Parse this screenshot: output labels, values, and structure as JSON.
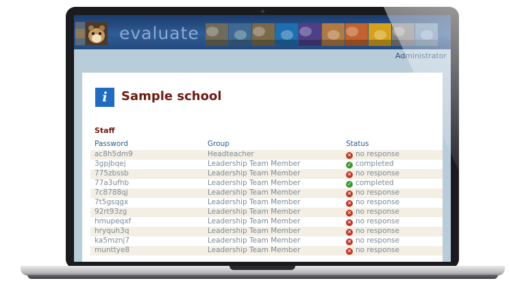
{
  "app": {
    "title": "evaluate"
  },
  "header": {
    "logo_thumb_icon": "hamster-photo-icon",
    "thumbnails": [
      {
        "name": "zebra-photo-icon",
        "color": "#6f6a5a"
      },
      {
        "name": "seascape-photo-icon",
        "color": "#3f6a8f"
      },
      {
        "name": "owl-photo-icon",
        "color": "#7a6a4a"
      },
      {
        "name": "underwater-photo-icon",
        "color": "#1c6fb0"
      },
      {
        "name": "lightning-photo-icon",
        "color": "#4e3f86"
      },
      {
        "name": "tiger-photo-icon",
        "color": "#b07a42"
      },
      {
        "name": "desert-photo-icon",
        "color": "#c2622c"
      },
      {
        "name": "flower-photo-icon",
        "color": "#d6a21c"
      },
      {
        "name": "zebra-2-photo-icon",
        "color": "#808080"
      },
      {
        "name": "coast-photo-icon",
        "color": "#6a8fb0"
      }
    ]
  },
  "user": {
    "name": "Administrator"
  },
  "page": {
    "title": "Sample school",
    "section": "Staff"
  },
  "table": {
    "columns": [
      "Password",
      "Group",
      "Status"
    ],
    "rows": [
      {
        "password": "ac8h5dm9",
        "group": "Headteacher",
        "status": "no response",
        "ok": false
      },
      {
        "password": "3gpjbqej",
        "group": "Leadership Team Member",
        "status": "completed",
        "ok": true
      },
      {
        "password": "775zbssb",
        "group": "Leadership Team Member",
        "status": "no response",
        "ok": false
      },
      {
        "password": "77a3ufhb",
        "group": "Leadership Team Member",
        "status": "completed",
        "ok": true
      },
      {
        "password": "7c8788qj",
        "group": "Leadership Team Member",
        "status": "no response",
        "ok": false
      },
      {
        "password": "7t5gsqgx",
        "group": "Leadership Team Member",
        "status": "no response",
        "ok": false
      },
      {
        "password": "92rt93zg",
        "group": "Leadership Team Member",
        "status": "no response",
        "ok": false
      },
      {
        "password": "hmupeqxf",
        "group": "Leadership Team Member",
        "status": "no response",
        "ok": false
      },
      {
        "password": "hryquh3q",
        "group": "Leadership Team Member",
        "status": "no response",
        "ok": false
      },
      {
        "password": "ka5mznj7",
        "group": "Leadership Team Member",
        "status": "no response",
        "ok": false
      },
      {
        "password": "munttye8",
        "group": "Leadership Team Member",
        "status": "no response",
        "ok": false
      }
    ]
  },
  "colors": {
    "header_bg": "#2e5c96",
    "title_red": "#6e1a10",
    "link_blue": "#2c4f7d",
    "status_bad": "#c8321e",
    "status_good": "#3c9a2c",
    "row_alt": "#f4efe4"
  }
}
